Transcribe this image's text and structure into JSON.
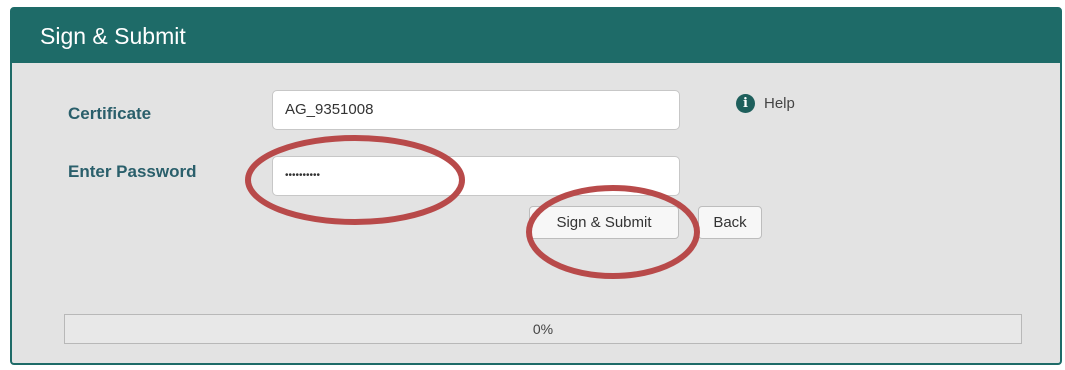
{
  "dialog": {
    "title": "Sign & Submit",
    "certificate_label": "Certificate",
    "certificate_value": "AG_9351008",
    "password_label": "Enter Password",
    "password_value": "••••••••••",
    "help_label": "Help",
    "help_icon": "info-icon",
    "sign_submit_label": "Sign & Submit",
    "back_label": "Back",
    "progress_text": "0%",
    "progress_value": 0
  },
  "colors": {
    "header": "#1e6b68",
    "annotation": "#b84a4a"
  }
}
